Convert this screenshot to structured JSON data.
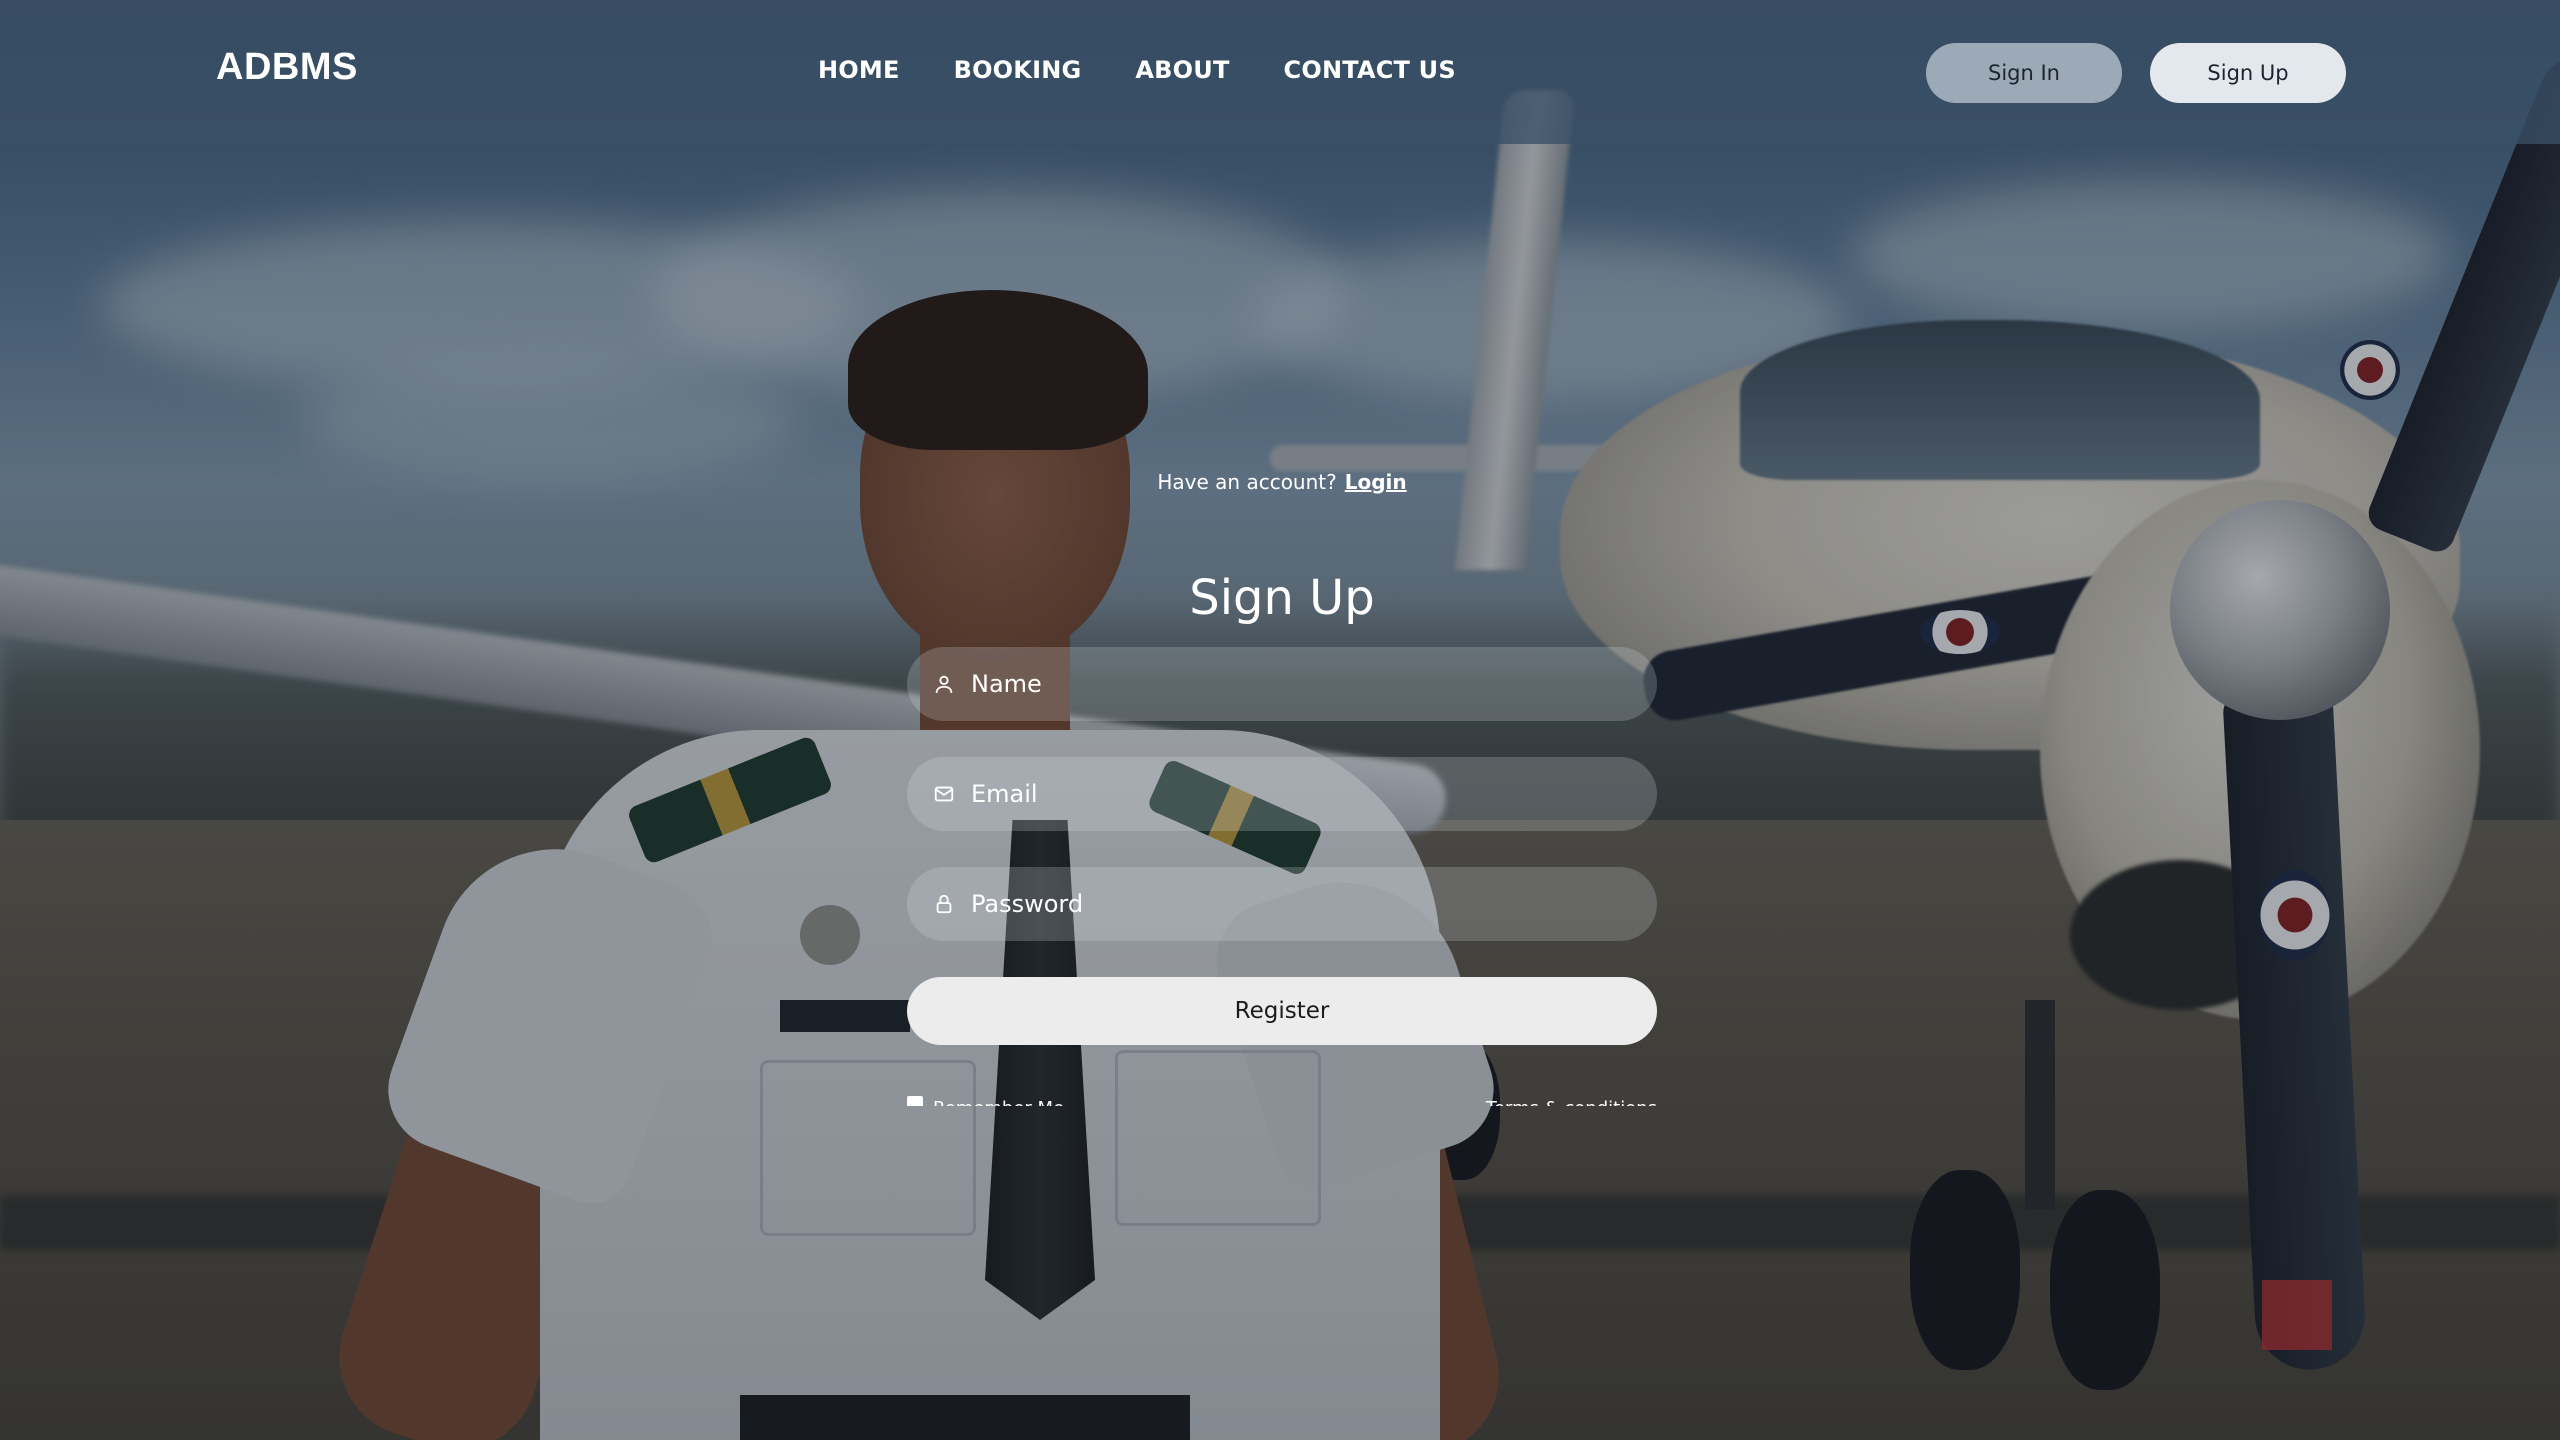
{
  "navbar": {
    "brand": "ADBMS",
    "links": [
      {
        "label": "HOME"
      },
      {
        "label": "BOOKING"
      },
      {
        "label": "ABOUT"
      },
      {
        "label": "CONTACT US"
      }
    ],
    "sign_in_label": "Sign In",
    "sign_up_label": "Sign Up"
  },
  "form": {
    "have_account_text": "Have an account?",
    "login_link": "Login",
    "title": "Sign Up",
    "fields": [
      {
        "icon": "user-icon",
        "placeholder": "Name"
      },
      {
        "icon": "mail-icon",
        "placeholder": "Email"
      },
      {
        "icon": "lock-icon",
        "placeholder": "Password"
      }
    ],
    "register_label": "Register",
    "remember_me_label": "Remember Me",
    "terms_label": "Terms & conditions"
  },
  "colors": {
    "navbar_bg": "#3a5066",
    "text": "#ffffff",
    "register_bg": "#ececec",
    "sign_in_bg": "#c4ced8",
    "sign_up_bg": "#ecf0f4"
  }
}
